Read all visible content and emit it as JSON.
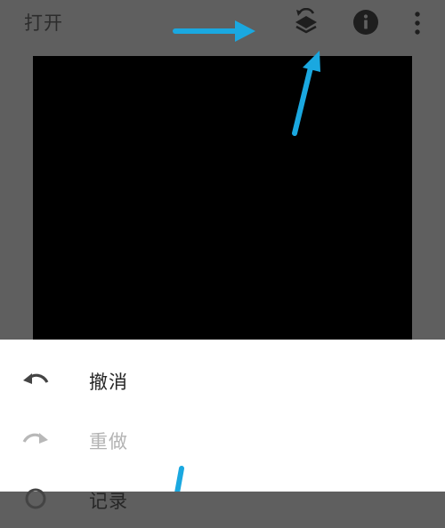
{
  "toolbar": {
    "open_label": "打开",
    "icons": [
      "layers-history-icon",
      "info-icon",
      "more-vert-icon"
    ]
  },
  "menu": {
    "items": [
      {
        "label": "撤消",
        "icon": "undo-icon",
        "enabled": true
      },
      {
        "label": "重做",
        "icon": "redo-icon",
        "enabled": false
      },
      {
        "label": "记录",
        "icon": "history-icon",
        "enabled": true
      }
    ]
  },
  "colors": {
    "toolbar_bg": "#5f5f5f",
    "canvas": "#000000",
    "sheet_bg": "#ffffff",
    "annotation_arrow": "#1aa8e0"
  }
}
